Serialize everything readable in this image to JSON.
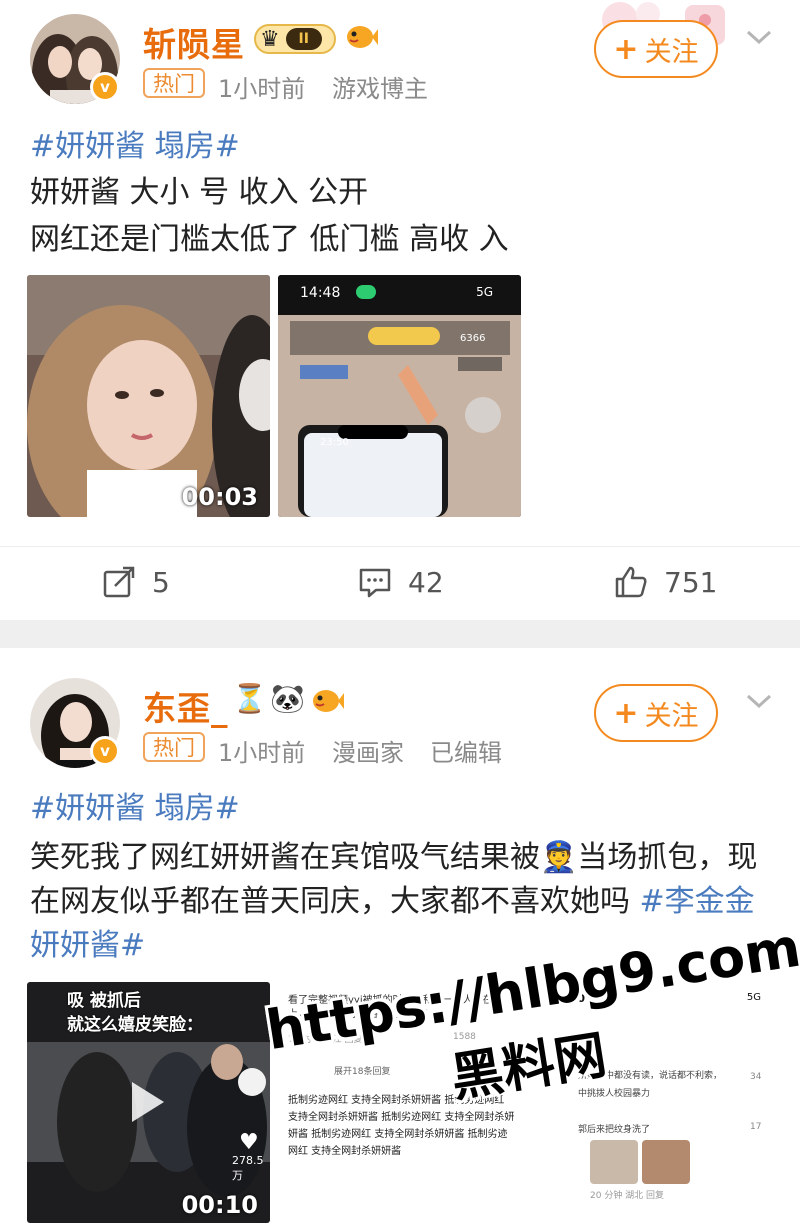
{
  "posts": [
    {
      "username": "斩陨星",
      "badge_level": "II",
      "hot_tag": "热门",
      "time": "1小时前",
      "role": "游戏博主",
      "follow_label": "关注",
      "topic": "#妍妍酱 塌房#",
      "lines": [
        "妍妍酱 大小 号 收入 公开",
        "网红还是门槛太低了 低门槛 高收 入"
      ],
      "video1_duration": "00:03",
      "screenshot_time": "14:48",
      "screenshot_signal": "5G",
      "screenshot_count": "6366",
      "screenshot_clock2": "23:50",
      "actions": {
        "reposts": "5",
        "comments": "42",
        "likes": "751"
      }
    },
    {
      "username": "东歪_",
      "hot_tag": "热门",
      "time": "1小时前",
      "role": "漫画家",
      "edited": "已编辑",
      "follow_label": "关注",
      "topic": "#妍妍酱 塌房#",
      "body_1": "笑死我了网红妍妍酱在宾馆吸气结果被",
      "body_2": "当场抓包，现在网友似乎都在普天同庆，大家都不喜欢她吗 ",
      "topic_2": "#李金金 妍妍酱#",
      "video_caption_1": "吸   被抓后",
      "video_caption_2": "就这么嬉皮笑脸：",
      "video_likes": "278.5万",
      "video_duration": "00:10",
      "shot2_top_text": "看了完整视频yyj被抓的时候正和另一个人躺在床上，警察来了穿个浴袍就起来了",
      "shot2_meta": "7小时前  浙江   回复",
      "shot2_likes": "1588",
      "shot2_expand": "展开18条回复",
      "shot2_spam": "抵制劣迹网红 支持全网封杀妍妍酱",
      "shot3_time": "02:10",
      "shot3_signal": "5G",
      "shot3_text1": "妍她高中都没有读，说话都不利索，",
      "shot3_text2": "中挑拨人校园暴力",
      "shot3_text3": "郭后来把纹身洗了",
      "shot3_meta": "20 分钟   湖北   回复",
      "shot3_likes1": "34",
      "shot3_likes2": "17"
    }
  ],
  "watermark": {
    "url": "https://hlbg9.com",
    "site": "黑料网"
  },
  "colors": {
    "username": "#e86b0c",
    "topic": "#4a7bbf",
    "follow": "#f48a1f",
    "meta": "#8a8a8a"
  }
}
